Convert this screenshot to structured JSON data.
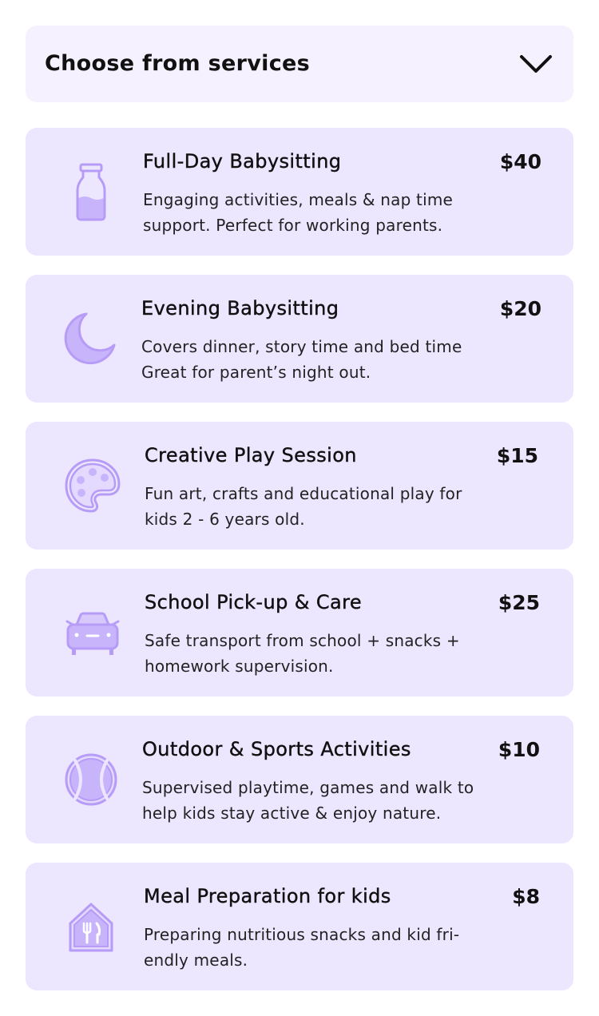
{
  "dropdown": {
    "label": "Choose from services",
    "icon": "chevron-down-icon"
  },
  "colors": {
    "dropdown_bg": "#f5f1ff",
    "card_bg": "#ede6ff",
    "icon_accent": "#b69cf7",
    "icon_fill": "#c8b4fb",
    "text": "#111111"
  },
  "services": [
    {
      "title": "Full-Day Babysitting",
      "description": "Engaging activities, meals & nap time support. Perfect for working parents.",
      "price": "$40",
      "icon": "milk-bottle-icon"
    },
    {
      "title": "Evening Babysitting",
      "description": "Covers dinner, story time and bed time Great for parent’s night out.",
      "price": "$20",
      "icon": "moon-icon"
    },
    {
      "title": "Creative Play Session",
      "description": "Fun art, crafts and educational play for kids 2 - 6 years old.",
      "price": "$15",
      "icon": "paint-palette-icon"
    },
    {
      "title": "School Pick-up & Care",
      "description": "Safe transport from school + snacks + homework supervision.",
      "price": "$25",
      "icon": "car-icon"
    },
    {
      "title": "Outdoor & Sports Activities",
      "description": "Supervised playtime, games and walk to help kids stay active & enjoy nature.",
      "price": "$10",
      "icon": "tennis-ball-icon"
    },
    {
      "title": "Meal Preparation for kids",
      "description": "Preparing nutritious snacks and kid fri-endly meals.",
      "price": "$8",
      "icon": "kitchen-utensils-icon"
    }
  ]
}
